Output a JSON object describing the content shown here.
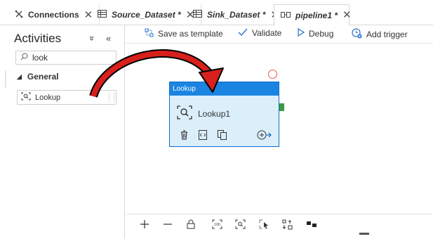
{
  "tabs": [
    {
      "label": "Connections",
      "icon": "connections-icon",
      "style": "bold",
      "close": "✕"
    },
    {
      "label": "Source_Dataset *",
      "icon": "table-icon",
      "style": "italic-bold",
      "close": "✕"
    },
    {
      "label": "Sink_Dataset *",
      "icon": "table-icon",
      "style": "italic-bold",
      "close": "✕"
    },
    {
      "label": "pipeline1 *",
      "icon": "pipeline-icon",
      "style": "italic-bold",
      "close": "✕",
      "active": true
    }
  ],
  "sidebar": {
    "title": "Activities",
    "collapse_all": "»",
    "hide_panel": "«",
    "search": {
      "value": "look",
      "icon": "search-icon"
    },
    "group": {
      "label": "General",
      "caret": "◢"
    },
    "items": [
      {
        "label": "Lookup",
        "icon": "lookup-icon"
      }
    ]
  },
  "toolbar": {
    "save_template": "Save as template",
    "validate": "Validate",
    "debug": "Debug",
    "add_trigger": "Add trigger"
  },
  "canvas": {
    "node": {
      "header": "Lookup",
      "name": "Lookup1",
      "icon": "lookup-icon",
      "actions": [
        "delete-icon",
        "code-icon",
        "copy-icon",
        "add-output-icon"
      ]
    },
    "handles": {
      "failure_color": "#e85a4f",
      "success_color": "#3d9a3d"
    },
    "controls": [
      "zoom-in-icon",
      "zoom-out-icon",
      "lock-icon",
      "zoom-100-icon",
      "zoom-fit-icon",
      "select-icon",
      "auto-align-icon",
      "layout-icon"
    ]
  },
  "annotation": {
    "color": "#d8201c",
    "icon": "curved-arrow"
  },
  "colors": {
    "accent": "#1b84e0",
    "node_bg": "#dbeffb",
    "toolbar_icon": "#2a71c9"
  }
}
